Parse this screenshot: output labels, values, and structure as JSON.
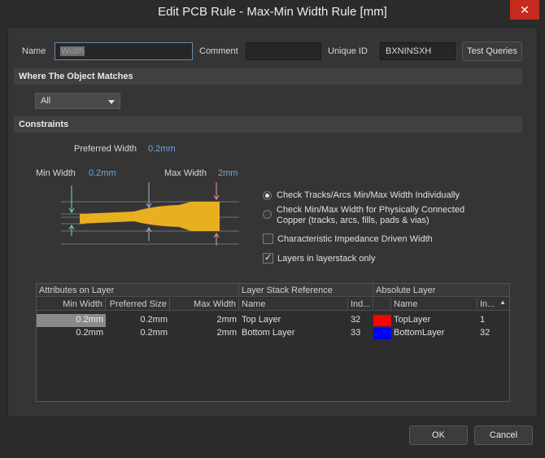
{
  "window": {
    "title": "Edit PCB Rule - Max-Min Width Rule [mm]",
    "close_glyph": "✕"
  },
  "header": {
    "name_label": "Name",
    "name_value": "Width",
    "comment_label": "Comment",
    "comment_value": "",
    "unique_id_label": "Unique ID",
    "unique_id_value": "BXNINSXH",
    "test_queries_label": "Test Queries"
  },
  "where_section": {
    "title": "Where The Object Matches",
    "dropdown_value": "All"
  },
  "constraints": {
    "title": "Constraints",
    "preferred_width_label": "Preferred Width",
    "preferred_width_value": "0.2mm",
    "min_width_label": "Min Width",
    "min_width_value": "0.2mm",
    "max_width_label": "Max Width",
    "max_width_value": "2mm",
    "track_color": "#e8b020",
    "options": {
      "radio1": "Check Tracks/Arcs Min/Max Width Individually",
      "radio2_line1": "Check Min/Max Width for Physically Connected",
      "radio2_line2": "Copper (tracks, arcs, fills, pads & vias)",
      "check1": "Characteristic Impedance Driven Width",
      "check2": "Layers in layerstack only"
    }
  },
  "table": {
    "group_headers": [
      "Attributes on Layer",
      "Layer Stack Reference",
      "Absolute Layer"
    ],
    "columns": [
      "Min Width",
      "Preferred Size",
      "Max Width",
      "Name",
      "Ind...",
      "Name",
      "In..."
    ],
    "rows": [
      {
        "min": "0.2mm",
        "pref": "0.2mm",
        "max": "2mm",
        "ref_name": "Top Layer",
        "ref_index": "32",
        "color": "#ff0000",
        "abs_name": "TopLayer",
        "abs_index": "1"
      },
      {
        "min": "0.2mm",
        "pref": "0.2mm",
        "max": "2mm",
        "ref_name": "Bottom Layer",
        "ref_index": "33",
        "color": "#0000ff",
        "abs_name": "BottomLayer",
        "abs_index": "32"
      }
    ]
  },
  "footer": {
    "ok_label": "OK",
    "cancel_label": "Cancel"
  }
}
